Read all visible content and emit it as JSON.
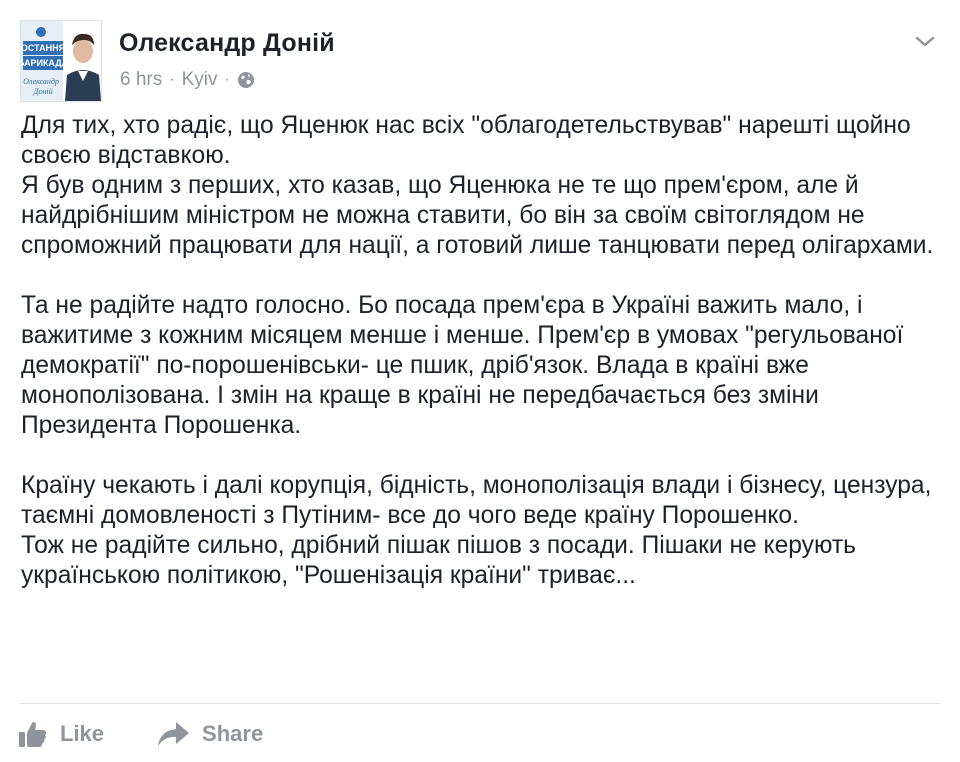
{
  "post": {
    "author": "Олександр Доній",
    "time": "6 hrs",
    "separator": "·",
    "location": "Kyiv",
    "avatar": {
      "badge_line1": "ОСТАННЯ",
      "badge_line2": "БАРИКАДА",
      "signature_line1": "Олександр",
      "signature_line2": "Доній"
    },
    "paragraphs": [
      "Для тих, хто радіє, що Яценюк нас всіх \"облагодетельствував\" нарешті щойно своєю відставкою.\nЯ був одним з перших, хто казав, що Яценюка не те що прем'єром, але й найдрібнішим міністром не можна ставити, бо він за своїм світоглядом не спроможний працювати для нації, а готовий лише танцювати перед олігархами.",
      "Та не радійте надто голосно. Бо посада прем'єра в Україні важить мало, і важитиме з кожним місяцем менше і менше. Прем'єр в умовах \"регульованої демократії\" по-порошенівськи- це пшик, дріб'язок. Влада в країні вже монополізована. І змін на краще в країні не передбачається без зміни Президента Порошенка.",
      "Країну чекають і далі корупція, бідність, монополізація влади і бізнесу, цензура, таємні домовленості з Путіним- все до чого веде країну Порошенко.\nТож не радійте сильно, дрібний пішак пішов з посади. Пішаки не керують українською політикою, \"Рошенізація країни\" триває..."
    ],
    "actions": {
      "like_label": "Like",
      "share_label": "Share"
    }
  },
  "icons": {
    "globe": "globe-icon",
    "chevron": "chevron-down-icon",
    "like": "thumbs-up-icon",
    "share": "share-arrow-icon"
  },
  "colors": {
    "text": "#1d2129",
    "secondary": "#90949c",
    "avatar_bg": "#2f6fb5"
  }
}
